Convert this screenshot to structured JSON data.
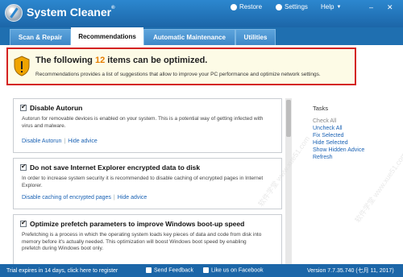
{
  "app": {
    "title": "System Cleaner",
    "registered": "®",
    "restore_label": "Restore",
    "settings_label": "Settings",
    "help_label": "Help",
    "minimize": "–",
    "close": "✕"
  },
  "tabs": [
    {
      "label": "Scan & Repair",
      "active": false
    },
    {
      "label": "Recommendations",
      "active": true
    },
    {
      "label": "Automatic Maintenance",
      "active": false
    },
    {
      "label": "Utilities",
      "active": false
    }
  ],
  "banner": {
    "title_prefix": "The following",
    "count": "12",
    "title_suffix": "items can be optimized.",
    "description": "Recommendations provides a list of suggestions that allow to improve your PC performance and optimize network settings.",
    "highlight_color": "#d42222",
    "count_color": "#e67e00"
  },
  "items": [
    {
      "title": "Disable Autorun",
      "checked": true,
      "description": "Autorun for removable devices is enabled on your system. This is a potential way of getting infected with virus and malware.",
      "action": "Disable Autorun",
      "hide": "Hide advice"
    },
    {
      "title": "Do not save Internet Explorer encrypted data to disk",
      "checked": true,
      "description": "In order to increase system security it is recommended to disable caching of encrypted pages in Internet Explorer.",
      "action": "Disable caching of encrypted pages",
      "hide": "Hide advice"
    },
    {
      "title": "Optimize prefetch parameters to improve Windows boot-up speed",
      "checked": true,
      "description": "Prefetching is a process in which the operating system loads key pieces of data and code from disk into memory before it's actually needed. This optimization will boost Windows boot speed by enabling prefetch during Windows boot only."
    }
  ],
  "tasks": {
    "title": "Tasks",
    "items": [
      {
        "label": "Check All",
        "enabled": false
      },
      {
        "label": "Uncheck All",
        "enabled": true
      },
      {
        "label": "Fix Selected",
        "enabled": true
      },
      {
        "label": "Hide Selected",
        "enabled": true
      },
      {
        "label": "Show Hidden Advice",
        "enabled": true
      },
      {
        "label": "Refresh",
        "enabled": true
      }
    ]
  },
  "status": {
    "trial": "Trial expires in 14 days, click here to register",
    "feedback": "Send Feedback",
    "facebook": "Like us on Facebook",
    "version": "Version 7.7.35.740 (七月 11, 2017)"
  },
  "watermark": {
    "text": "软件学堂 www.xue51.com"
  },
  "colors": {
    "titlebar": "#1c66a8",
    "link": "#1a62b4"
  }
}
